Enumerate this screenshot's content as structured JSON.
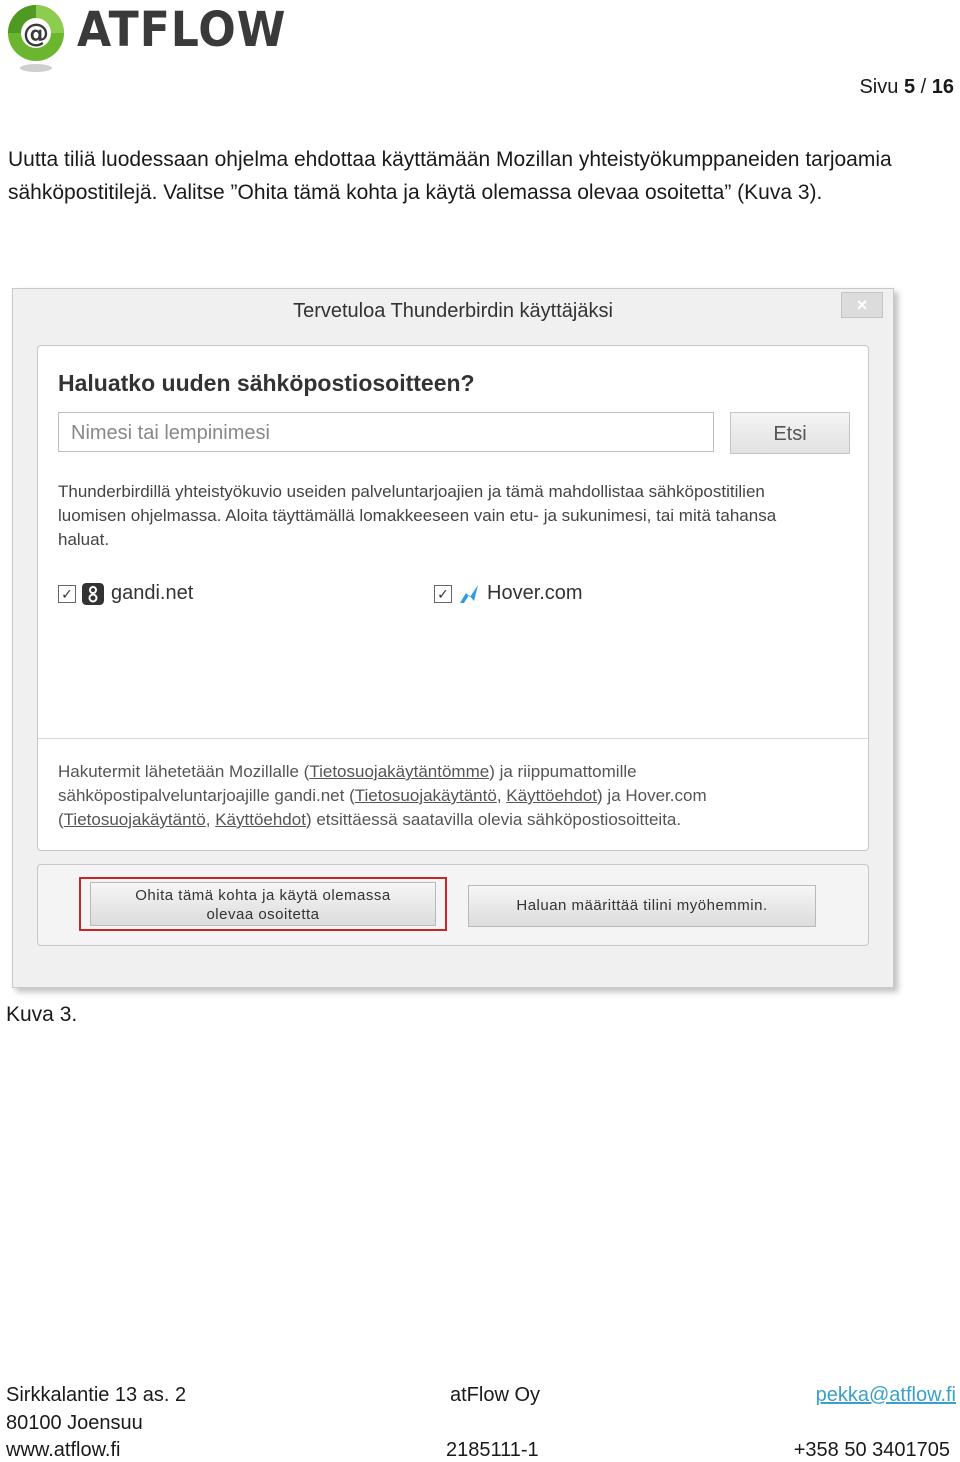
{
  "header": {
    "logo_text": "ATFLOW",
    "page_label": "Sivu",
    "page_current": "5",
    "page_separator": "/",
    "page_total": "16"
  },
  "intro_text": "Uutta tiliä luodessaan ohjelma ehdottaa käyttämään Mozillan yhteistyökumppaneiden tarjoamia sähköpostitilejä. Valitse ”Ohita tämä kohta ja käytä olemassa olevaa osoitetta” (Kuva 3).",
  "dialog": {
    "title": "Tervetuloa Thunderbirdin käyttäjäksi",
    "close_glyph": "×",
    "question": "Haluatko uuden sähköpostiosoitteen?",
    "name_placeholder": "Nimesi tai lempinimesi",
    "search_label": "Etsi",
    "description": "Thunderbirdillä yhteistyökuvio useiden palveluntarjoajien ja tämä mahdollistaa sähköpostitilien luomisen ohjelmassa. Aloita täyttämällä lomakkeeseen vain etu- ja sukunimesi, tai mitä tahansa haluat.",
    "providers": [
      {
        "name": "gandi.net",
        "checked": "✓"
      },
      {
        "name": "Hover.com",
        "checked": "✓"
      }
    ],
    "privacy": {
      "p1": "Hakutermit lähetetään Mozillalle (",
      "link1": "Tietosuojakäytäntömme",
      "p2": ") ja riippumattomille sähköpostipalveluntarjoajille gandi.net (",
      "link2": "Tietosuojakäytäntö",
      "p3": ", ",
      "link3": "Käyttöehdot",
      "p4": ") ja Hover.com (",
      "link4": "Tietosuojakäytäntö",
      "p5": ", ",
      "link5": "Käyttöehdot",
      "p6": ") etsittäessä saatavilla olevia sähköpostiosoitteita."
    },
    "skip_line1": "Ohita tämä kohta ja käytä olemassa",
    "skip_line2": "olevaa osoitetta",
    "later_label": "Haluan määrittää tilini myöhemmin.",
    "highlight_color": "#c8242a"
  },
  "caption": "Kuva 3.",
  "footer": {
    "address1": "Sirkkalantie 13 as. 2",
    "address2": "80100 Joensuu",
    "web": "www.atflow.fi",
    "company": "atFlow Oy",
    "business_id": "2185111-1",
    "email": "pekka@atflow.fi",
    "phone": "+358 50 3401705"
  },
  "colors": {
    "logo_green": "#6bb62e",
    "logo_text": "#3a3a3a",
    "link_blue": "#3aa0c8"
  }
}
